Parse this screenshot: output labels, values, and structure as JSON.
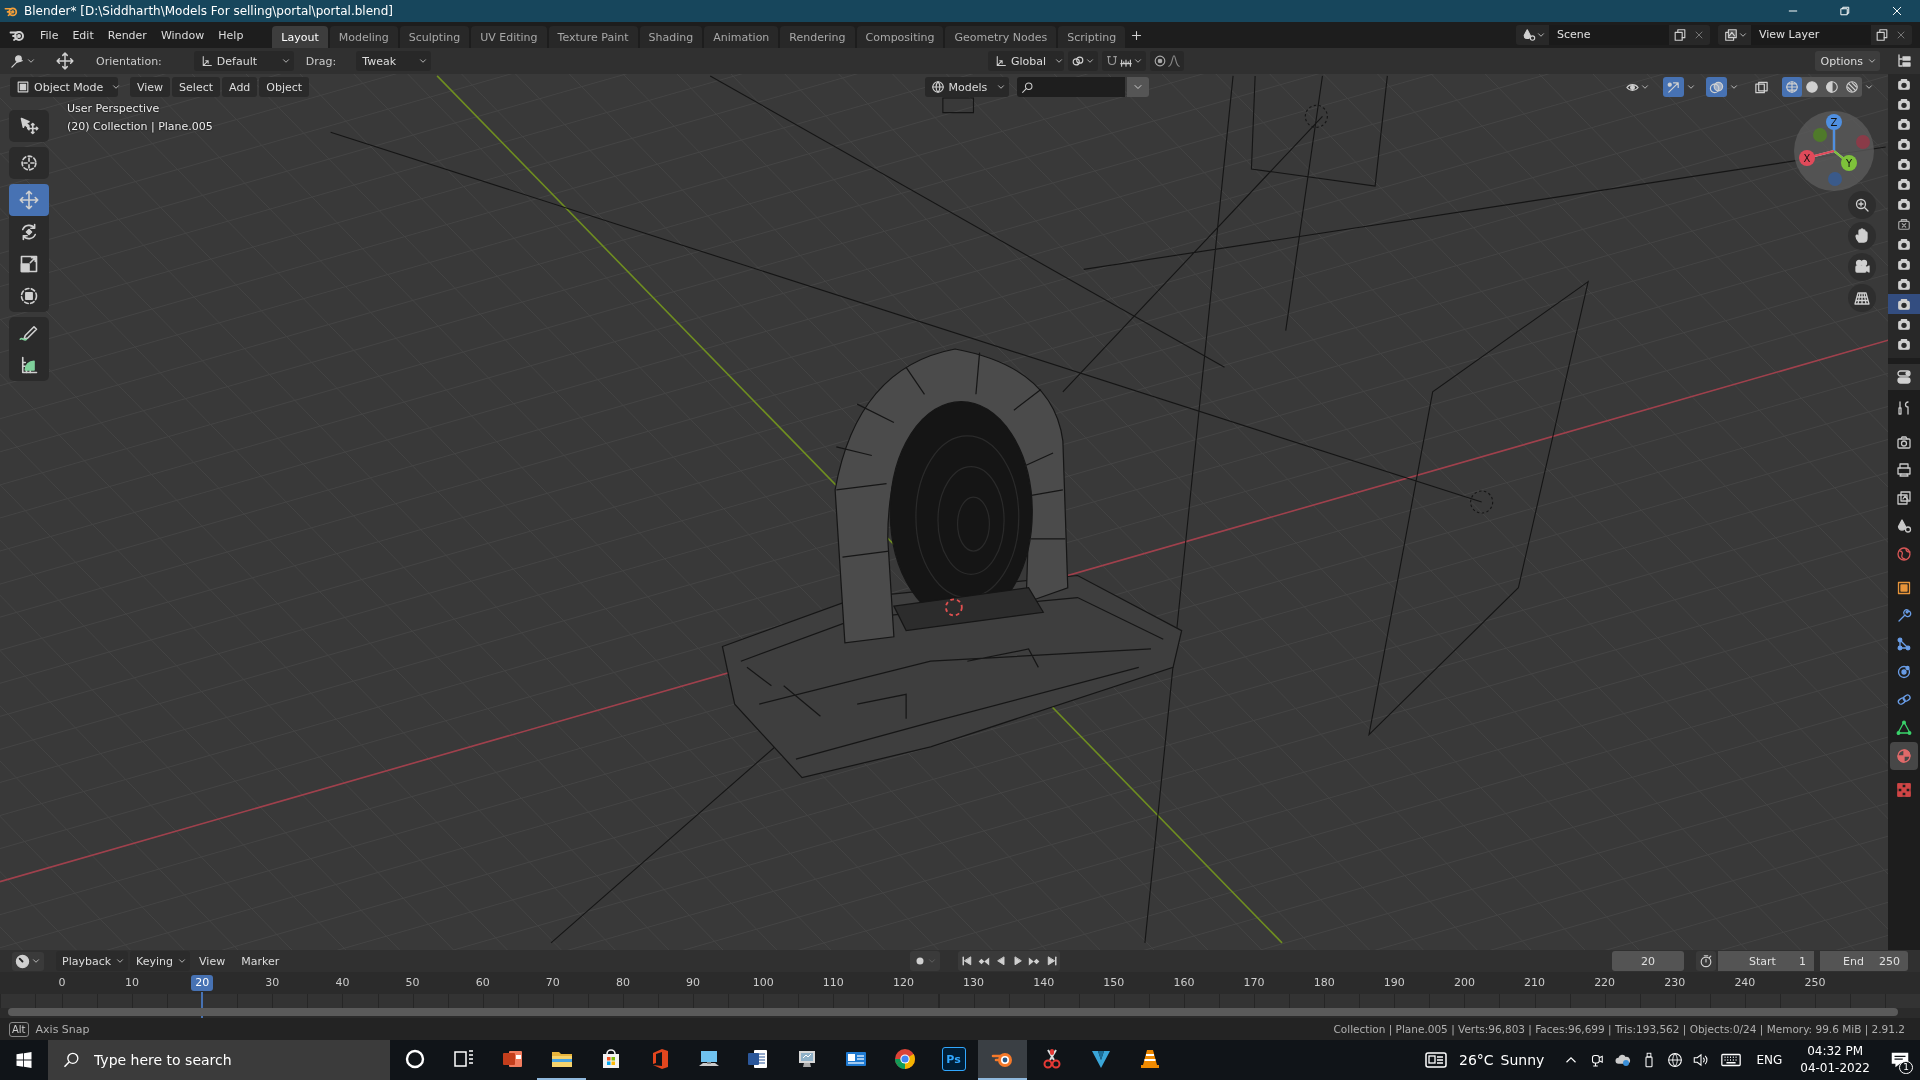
{
  "window": {
    "title": "Blender* [D:\\Siddharth\\Models For selling\\portal\\portal.blend]"
  },
  "menu_bar": {
    "menus": [
      "File",
      "Edit",
      "Render",
      "Window",
      "Help"
    ],
    "workspaces": [
      {
        "label": "Layout",
        "selected": true
      },
      {
        "label": "Modeling",
        "selected": false
      },
      {
        "label": "Sculpting",
        "selected": false
      },
      {
        "label": "UV Editing",
        "selected": false
      },
      {
        "label": "Texture Paint",
        "selected": false
      },
      {
        "label": "Shading",
        "selected": false
      },
      {
        "label": "Animation",
        "selected": false
      },
      {
        "label": "Rendering",
        "selected": false
      },
      {
        "label": "Compositing",
        "selected": false
      },
      {
        "label": "Geometry Nodes",
        "selected": false
      },
      {
        "label": "Scripting",
        "selected": false
      }
    ],
    "scene": "Scene",
    "view_layer": "View Layer"
  },
  "tool_header": {
    "orientation_label": "Orientation:",
    "orientation": "Default",
    "drag_label": "Drag:",
    "drag": "Tweak",
    "transform_orientation": "Global",
    "options": "Options"
  },
  "viewport_header": {
    "mode": "Object Mode",
    "menus": [
      "View",
      "Select",
      "Add",
      "Object"
    ],
    "collection": "Models",
    "gizmos": true,
    "overlays": true,
    "xray": false,
    "shading": [
      {
        "kind": "wireframe",
        "selected": true
      },
      {
        "kind": "solid",
        "selected": false
      },
      {
        "kind": "material",
        "selected": false
      },
      {
        "kind": "rendered",
        "selected": false
      }
    ]
  },
  "toolbar": [
    {
      "kind": "select",
      "selected": false
    },
    {
      "kind": "cursor",
      "selected": false
    },
    {
      "kind": "move",
      "selected": true
    },
    {
      "kind": "rotate",
      "selected": false
    },
    {
      "kind": "scale",
      "selected": false
    },
    {
      "kind": "transform",
      "selected": false
    },
    {
      "kind": "annotate",
      "selected": false
    },
    {
      "kind": "measure",
      "selected": false
    }
  ],
  "viewport_info": [
    "User Perspective",
    "(20) Collection | Plane.005"
  ],
  "navigation_gizmo": {
    "x": "X",
    "y": "Y",
    "z": "Z"
  },
  "outliner": [
    {
      "render": true,
      "selected": false
    },
    {
      "render": true,
      "selected": false
    },
    {
      "render": true,
      "selected": false
    },
    {
      "render": true,
      "selected": false
    },
    {
      "render": true,
      "selected": false
    },
    {
      "render": true,
      "selected": false
    },
    {
      "render": true,
      "selected": false
    },
    {
      "render": false,
      "selected": false
    },
    {
      "render": true,
      "selected": false
    },
    {
      "render": true,
      "selected": false
    },
    {
      "render": true,
      "selected": false
    },
    {
      "render": true,
      "selected": true
    },
    {
      "render": true,
      "selected": false
    },
    {
      "render": true,
      "selected": false
    }
  ],
  "properties_tabs": [
    {
      "kind": "tool",
      "selected": false
    },
    {
      "kind": "render",
      "selected": false
    },
    {
      "kind": "output",
      "selected": false
    },
    {
      "kind": "view_layer",
      "selected": false
    },
    {
      "kind": "scene",
      "selected": false
    },
    {
      "kind": "world",
      "selected": false
    },
    {
      "kind": "object",
      "selected": false
    },
    {
      "kind": "modifiers",
      "selected": false
    },
    {
      "kind": "particles",
      "selected": false
    },
    {
      "kind": "physics",
      "selected": false
    },
    {
      "kind": "constraints",
      "selected": false
    },
    {
      "kind": "data",
      "selected": false
    },
    {
      "kind": "material",
      "selected": true
    },
    {
      "kind": "texture",
      "selected": false
    }
  ],
  "timeline": {
    "menus": [
      "Playback",
      "Keying",
      "View",
      "Marker"
    ],
    "current_frame": "20",
    "start_label": "Start",
    "start": "1",
    "end_label": "End",
    "end": "250",
    "ruler": [
      {
        "label": "0",
        "selected": false
      },
      {
        "label": "10",
        "selected": false
      },
      {
        "label": "20",
        "selected": true
      },
      {
        "label": "30",
        "selected": false
      },
      {
        "label": "40",
        "selected": false
      },
      {
        "label": "50",
        "selected": false
      },
      {
        "label": "60",
        "selected": false
      },
      {
        "label": "70",
        "selected": false
      },
      {
        "label": "80",
        "selected": false
      },
      {
        "label": "90",
        "selected": false
      },
      {
        "label": "100",
        "selected": false
      },
      {
        "label": "110",
        "selected": false
      },
      {
        "label": "120",
        "selected": false
      },
      {
        "label": "130",
        "selected": false
      },
      {
        "label": "140",
        "selected": false
      },
      {
        "label": "150",
        "selected": false
      },
      {
        "label": "160",
        "selected": false
      },
      {
        "label": "170",
        "selected": false
      },
      {
        "label": "180",
        "selected": false
      },
      {
        "label": "190",
        "selected": false
      },
      {
        "label": "200",
        "selected": false
      },
      {
        "label": "210",
        "selected": false
      },
      {
        "label": "220",
        "selected": false
      },
      {
        "label": "230",
        "selected": false
      },
      {
        "label": "240",
        "selected": false
      },
      {
        "label": "250",
        "selected": false
      }
    ]
  },
  "status_bar": {
    "key": "Alt",
    "hint": "Axis Snap",
    "stats": "Collection | Plane.005 | Verts:96,803 | Faces:96,699 | Tris:193,562 | Objects:0/24 | Memory: 99.6 MiB | 2.91.2"
  },
  "taskbar": {
    "search_placeholder": "Type here to search",
    "apps": [
      {
        "kind": "cortana",
        "running": false,
        "selected": false
      },
      {
        "kind": "taskview",
        "running": false,
        "selected": false
      },
      {
        "kind": "slides",
        "running": false,
        "selected": false
      },
      {
        "kind": "folder",
        "running": true,
        "selected": false
      },
      {
        "kind": "store",
        "running": false,
        "selected": false
      },
      {
        "kind": "office",
        "running": false,
        "selected": false
      },
      {
        "kind": "computer",
        "running": false,
        "selected": false
      },
      {
        "kind": "document",
        "running": false,
        "selected": false
      },
      {
        "kind": "monitor",
        "running": false,
        "selected": false
      },
      {
        "kind": "mail",
        "running": false,
        "selected": false
      },
      {
        "kind": "browser",
        "running": false,
        "selected": false
      },
      {
        "kind": "image_editor",
        "label": "Ps",
        "running": false,
        "selected": false
      },
      {
        "kind": "blender",
        "running": true,
        "selected": true
      },
      {
        "kind": "scissors",
        "running": false,
        "selected": false
      },
      {
        "kind": "vshape",
        "running": false,
        "selected": false
      },
      {
        "kind": "cone",
        "running": false,
        "selected": false
      }
    ],
    "temperature": "26°C",
    "condition": "Sunny",
    "language": "ENG",
    "time": "04:32 PM",
    "date": "04-01-2022",
    "notifications": "1"
  }
}
